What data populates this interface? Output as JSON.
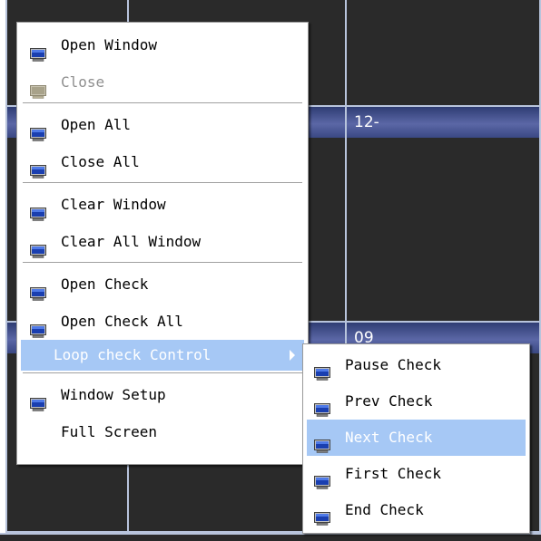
{
  "grid": {
    "cells": [
      {
        "label": ""
      },
      {
        "label": "12-"
      },
      {
        "label": "09"
      }
    ]
  },
  "main_menu": {
    "items": [
      {
        "label": "Open Window",
        "icon": "monitor-icon"
      },
      {
        "label": "Close",
        "icon": "monitor-icon-disabled",
        "disabled": true
      },
      {
        "label": "Open All",
        "icon": "monitor-icon"
      },
      {
        "label": "Close All",
        "icon": "monitor-icon"
      },
      {
        "label": "Clear Window",
        "icon": "monitor-icon"
      },
      {
        "label": "Clear All Window",
        "icon": "monitor-icon"
      },
      {
        "label": "Open Check",
        "icon": "monitor-icon"
      },
      {
        "label": "Open Check All",
        "icon": "monitor-icon"
      },
      {
        "label": "Loop check Control",
        "submenu": true,
        "highlighted": true
      },
      {
        "label": "Window Setup",
        "icon": "monitor-icon"
      },
      {
        "label": "Full Screen"
      }
    ]
  },
  "sub_menu": {
    "items": [
      {
        "label": "Pause Check",
        "icon": "monitor-icon"
      },
      {
        "label": "Prev Check",
        "icon": "monitor-icon"
      },
      {
        "label": "Next Check",
        "icon": "monitor-icon",
        "highlighted": true
      },
      {
        "label": "First Check",
        "icon": "monitor-icon"
      },
      {
        "label": "End Check",
        "icon": "monitor-icon"
      }
    ]
  },
  "colors": {
    "highlight": "#a6c8f5",
    "cell_header": "#5b67a6",
    "cell_border": "#b8c4dc",
    "cell_bg": "#2a2a2a"
  }
}
